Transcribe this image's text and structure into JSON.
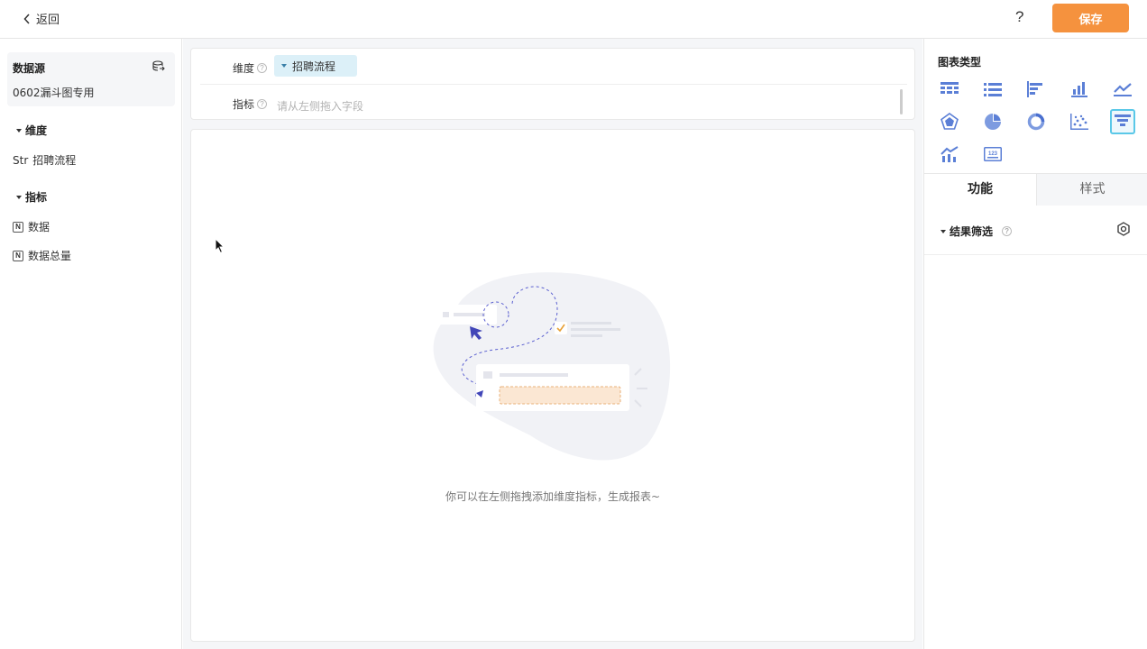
{
  "topbar": {
    "back_label": "返回",
    "help_label": "?",
    "save_label": "保存"
  },
  "datasource": {
    "title": "数据源",
    "name": "0602漏斗图专用"
  },
  "dimensions": {
    "title": "维度",
    "items": [
      {
        "type": "Str",
        "label": "招聘流程"
      }
    ]
  },
  "metrics": {
    "title": "指标",
    "items": [
      {
        "type": "N",
        "label": "数据"
      },
      {
        "type": "N",
        "label": "数据总量"
      }
    ]
  },
  "config": {
    "dimension_label": "维度",
    "dimension_tag": "招聘流程",
    "metric_label": "指标",
    "metric_placeholder": "请从左侧拖入字段"
  },
  "canvas": {
    "empty_text": "你可以在左侧拖拽添加维度指标，生成报表~"
  },
  "right_panel": {
    "chart_type_title": "图表类型",
    "chart_types": [
      "table-icon",
      "list-icon",
      "bar-horizontal-icon",
      "bar-vertical-icon",
      "line-icon",
      "radar-icon",
      "pie-icon",
      "donut-icon",
      "scatter-icon",
      "funnel-icon",
      "combo-icon",
      "number-card-icon"
    ],
    "selected_chart_type": "funnel-icon",
    "tabs": [
      "功能",
      "样式"
    ],
    "active_tab": "功能",
    "filter_label": "结果筛选"
  },
  "colors": {
    "accent_orange": "#f5923e",
    "accent_blue": "#5ac8e8",
    "icon_blue": "#5b7fd6"
  }
}
